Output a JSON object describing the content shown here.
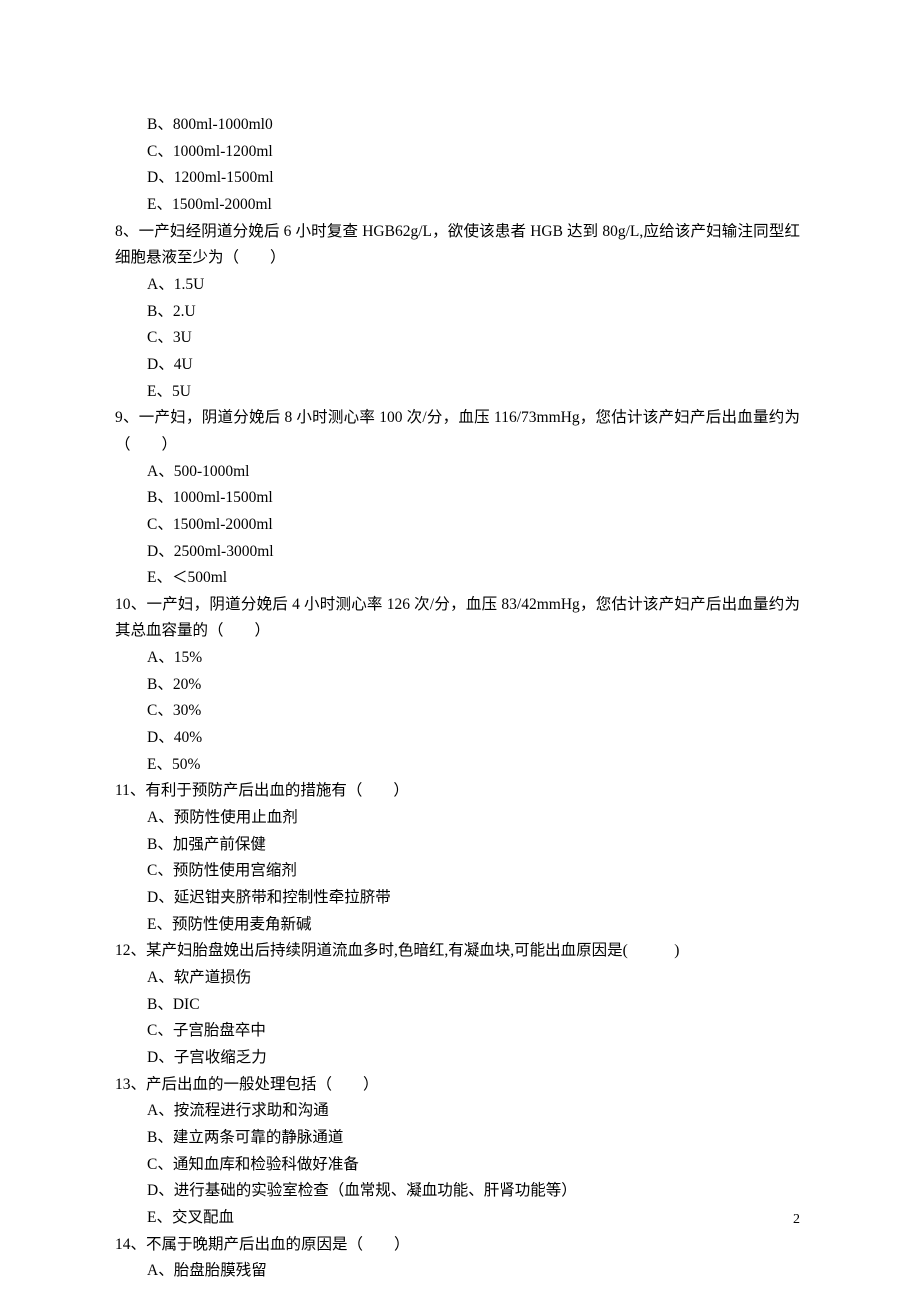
{
  "frag7": {
    "B": "B、800ml-1000ml0",
    "C": "C、1000ml-1200ml",
    "D": "D、1200ml-1500ml",
    "E": "E、1500ml-2000ml"
  },
  "q8": {
    "stem": "8、一产妇经阴道分娩后 6 小时复查 HGB62g/L，欲使该患者 HGB 达到 80g/L,应给该产妇输注同型红细胞悬液至少为（　　）",
    "A": "A、1.5U",
    "B": "B、2.U",
    "C": "C、3U",
    "D": "D、4U",
    "E": "E、5U"
  },
  "q9": {
    "stem": "9、一产妇，阴道分娩后 8 小时测心率 100 次/分，血压 116/73mmHg，您估计该产妇产后出血量约为（　　）",
    "A": "A、500-1000ml",
    "B": "B、1000ml-1500ml",
    "C": "C、1500ml-2000ml",
    "D": "D、2500ml-3000ml",
    "E": "E、＜500ml"
  },
  "q10": {
    "stem": "10、一产妇，阴道分娩后 4 小时测心率 126 次/分，血压 83/42mmHg，您估计该产妇产后出血量约为其总血容量的（　　）",
    "A": "A、15%",
    "B": "B、20%",
    "C": "C、30%",
    "D": "D、40%",
    "E": "E、50%"
  },
  "q11": {
    "stem": "11、有利于预防产后出血的措施有（　　）",
    "A": "A、预防性使用止血剂",
    "B": "B、加强产前保健",
    "C": "C、预防性使用宫缩剂",
    "D": "D、延迟钳夹脐带和控制性牵拉脐带",
    "E": "E、预防性使用麦角新碱"
  },
  "q12": {
    "stem": "12、某产妇胎盘娩出后持续阴道流血多时,色暗红,有凝血块,可能出血原因是(　　　)",
    "A": "A、软产道损伤",
    "B": "B、DIC",
    "C": "C、子宫胎盘卒中",
    "D": "D、子宫收缩乏力"
  },
  "q13": {
    "stem": "13、产后出血的一般处理包括（　　）",
    "A": "A、按流程进行求助和沟通",
    "B": "B、建立两条可靠的静脉通道",
    "C": "C、通知血库和检验科做好准备",
    "D": "D、进行基础的实验室检查（血常规、凝血功能、肝肾功能等）",
    "E": "E、交叉配血"
  },
  "q14": {
    "stem": "14、不属于晚期产后出血的原因是（　　）",
    "A": "A、胎盘胎膜残留"
  },
  "pageNumber": "2"
}
